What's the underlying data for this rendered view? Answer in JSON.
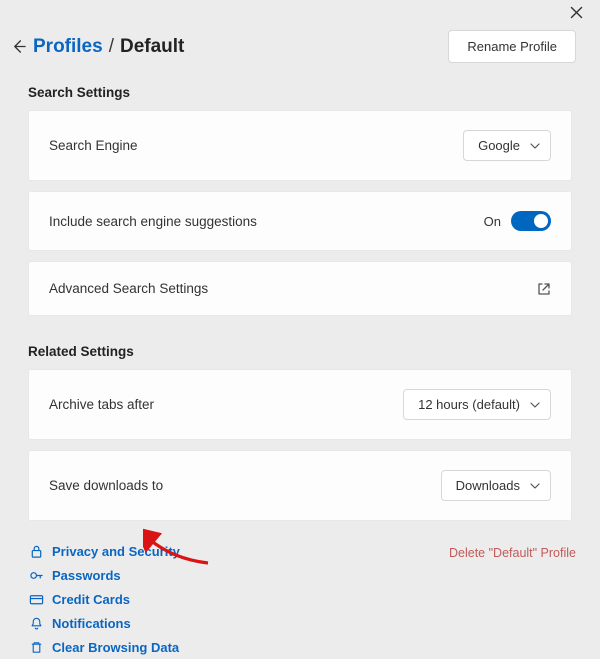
{
  "header": {
    "breadcrumb_link": "Profiles",
    "breadcrumb_sep": "/",
    "breadcrumb_current": "Default",
    "rename_label": "Rename Profile"
  },
  "sections": {
    "search_title": "Search Settings",
    "related_title": "Related Settings"
  },
  "search": {
    "engine_label": "Search Engine",
    "engine_value": "Google",
    "suggestions_label": "Include search engine suggestions",
    "suggestions_state": "On",
    "advanced_label": "Advanced Search Settings"
  },
  "related": {
    "archive_label": "Archive tabs after",
    "archive_value": "12 hours (default)",
    "save_label": "Save downloads to",
    "save_value": "Downloads"
  },
  "links": {
    "privacy": "Privacy and Security",
    "passwords": "Passwords",
    "credit": "Credit Cards",
    "notifications": "Notifications",
    "clear": "Clear Browsing Data"
  },
  "footer": {
    "delete_label": "Delete \"Default\" Profile"
  }
}
